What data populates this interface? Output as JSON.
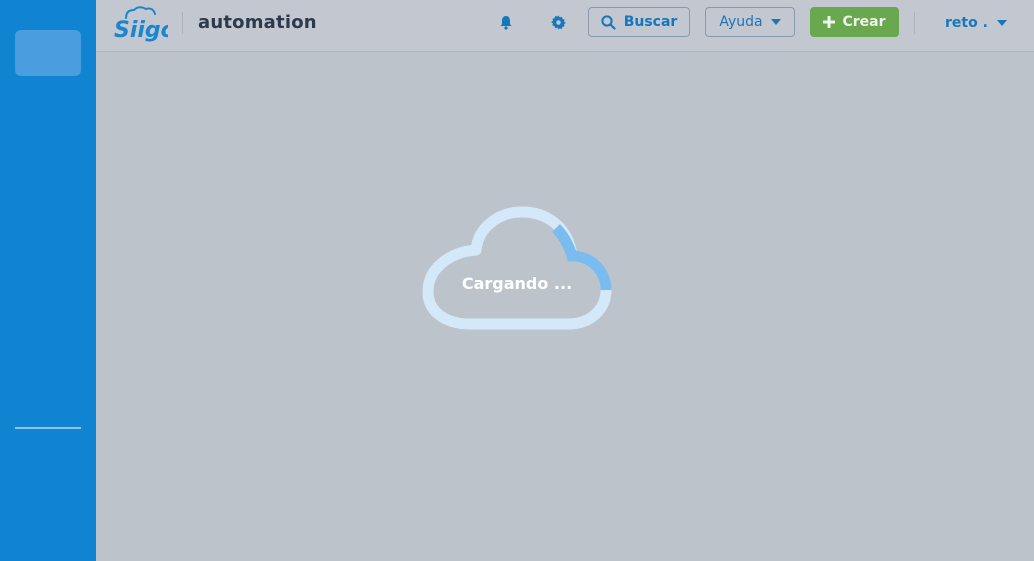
{
  "brand": {
    "logo_text": "Siigo",
    "primary_color": "#1083d1",
    "create_color": "#6aa84f"
  },
  "header": {
    "company_name": "automation",
    "notifications_icon": "bell-icon",
    "settings_icon": "gear-icon",
    "search_label": "Buscar",
    "help_label": "Ayuda",
    "create_label": "Crear",
    "user_name": "reto ."
  },
  "loading": {
    "text": "Cargando ..."
  }
}
